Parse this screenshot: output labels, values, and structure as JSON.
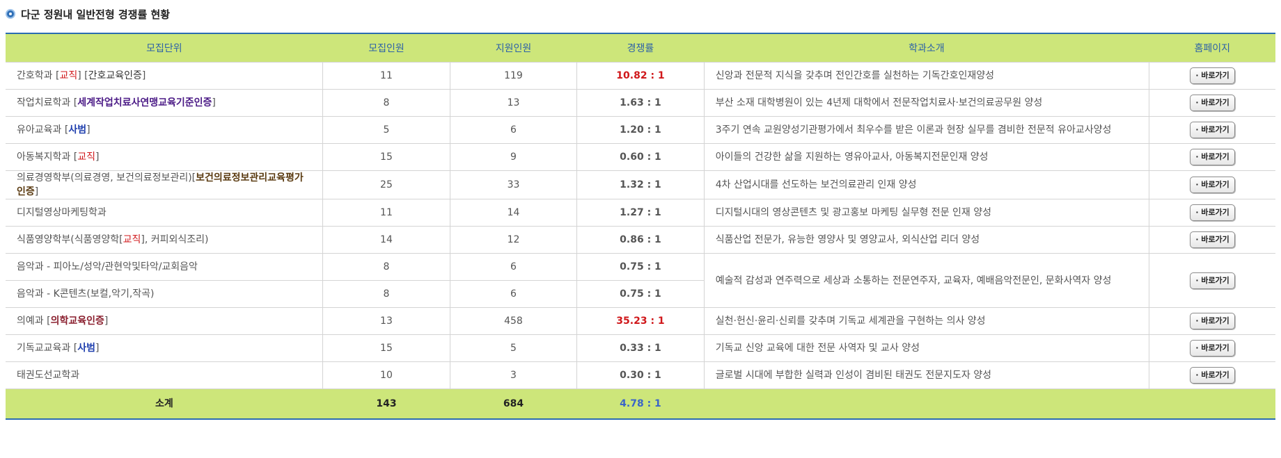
{
  "title": "다군 정원내 일반전형 경쟁률 현황",
  "headers": {
    "unit": "모집단위",
    "quota": "모집인원",
    "applicants": "지원인원",
    "ratio": "경쟁률",
    "intro": "학과소개",
    "homepage": "홈페이지"
  },
  "button_label": "· 바로가기",
  "rows": [
    {
      "name": "간호학과",
      "tags": [
        {
          "t": " [",
          "c": ""
        },
        {
          "t": "교직",
          "c": "red"
        },
        {
          "t": "] [",
          "c": ""
        },
        {
          "t": "간호교육인증",
          "c": "dark"
        },
        {
          "t": "]",
          "c": ""
        }
      ],
      "quota": "11",
      "applicants": "119",
      "ratio": "10.82 : 1",
      "ratio_high": true,
      "intro": "신앙과 전문적 지식을 갖추며 전인간호를 실천하는 기독간호인재양성"
    },
    {
      "name": "작업치료학과",
      "tags": [
        {
          "t": " [",
          "c": ""
        },
        {
          "t": "세계작업치료사연맹교육기준인증",
          "c": "purple"
        },
        {
          "t": "]",
          "c": ""
        }
      ],
      "quota": "8",
      "applicants": "13",
      "ratio": "1.63 : 1",
      "intro": "부산 소재 대학병원이 있는 4년제 대학에서 전문작업치료사·보건의료공무원 양성"
    },
    {
      "name": "유아교육과",
      "tags": [
        {
          "t": " [",
          "c": ""
        },
        {
          "t": "사범",
          "c": "blue"
        },
        {
          "t": "]",
          "c": ""
        }
      ],
      "quota": "5",
      "applicants": "6",
      "ratio": "1.20 : 1",
      "intro": "3주기 연속 교원양성기관평가에서 최우수를 받은 이론과 현장 실무를 겸비한 전문적 유아교사양성",
      "tall": true
    },
    {
      "name": "아동복지학과",
      "tags": [
        {
          "t": " [",
          "c": ""
        },
        {
          "t": "교직",
          "c": "red"
        },
        {
          "t": "]",
          "c": ""
        }
      ],
      "quota": "15",
      "applicants": "9",
      "ratio": "0.60 : 1",
      "intro": "아이들의 건강한 삶을 지원하는 영유아교사, 아동복지전문인재 양성"
    },
    {
      "name": "의료경영학부(의료경영, 보건의료정보관리)",
      "tags": [
        {
          "t": "[",
          "c": ""
        },
        {
          "t": "보건의료정보관리교육평가인증",
          "c": "brown"
        },
        {
          "t": "]",
          "c": ""
        }
      ],
      "quota": "25",
      "applicants": "33",
      "ratio": "1.32 : 1",
      "intro": "4차 산업시대를 선도하는 보건의료관리 인재 양성",
      "tall": true
    },
    {
      "name": "디지털영상마케팅학과",
      "tags": [],
      "quota": "11",
      "applicants": "14",
      "ratio": "1.27 : 1",
      "intro": "디지털시대의 영상콘텐츠 및 광고홍보 마케팅 실무형 전문 인재 양성"
    },
    {
      "name": "식품영양학부(식품영양학",
      "tags": [
        {
          "t": "[",
          "c": ""
        },
        {
          "t": "교직",
          "c": "red"
        },
        {
          "t": "], 커피외식조리)",
          "c": ""
        }
      ],
      "quota": "14",
      "applicants": "12",
      "ratio": "0.86 : 1",
      "intro": "식품산업 전문가, 유능한 영양사 및 영양교사, 외식산업 리더 양성"
    },
    {
      "name": "음악과 - 피아노/성악/관현악및타악/교회음악",
      "tags": [],
      "quota": "8",
      "applicants": "6",
      "ratio": "0.75 : 1",
      "intro": "예술적 감성과 연주력으로 세상과 소통하는 전문연주자, 교육자, 예배음악전문인, 문화사역자 양성",
      "span": 2
    },
    {
      "name": "음악과 - K콘텐츠(보컬,악기,작곡)",
      "tags": [],
      "quota": "8",
      "applicants": "6",
      "ratio": "0.75 : 1",
      "merged": true
    },
    {
      "name": "의예과",
      "tags": [
        {
          "t": " [",
          "c": ""
        },
        {
          "t": "의학교육인증",
          "c": "maroon"
        },
        {
          "t": "]",
          "c": ""
        }
      ],
      "quota": "13",
      "applicants": "458",
      "ratio": "35.23 : 1",
      "ratio_high": true,
      "intro": "실천·헌신·윤리·신뢰를 갖추며 기독교 세계관을 구현하는 의사 양성"
    },
    {
      "name": "기독교교육과",
      "tags": [
        {
          "t": " [",
          "c": ""
        },
        {
          "t": "사범",
          "c": "blue"
        },
        {
          "t": "]",
          "c": ""
        }
      ],
      "quota": "15",
      "applicants": "5",
      "ratio": "0.33 : 1",
      "intro": "기독교 신앙 교육에 대한 전문 사역자 및 교사 양성"
    },
    {
      "name": "태권도선교학과",
      "tags": [],
      "quota": "10",
      "applicants": "3",
      "ratio": "0.30 : 1",
      "intro": "글로벌 시대에 부합한 실력과 인성이 겸비된 태권도 전문지도자 양성"
    }
  ],
  "total": {
    "label": "소계",
    "quota": "143",
    "applicants": "684",
    "ratio": "4.78 : 1"
  },
  "colors": {
    "header_bg": "#cde67a",
    "header_text": "#2d62a8",
    "border_accent": "#2b6cb0",
    "high_ratio": "#d0181b",
    "total_ratio": "#3a64c8"
  }
}
